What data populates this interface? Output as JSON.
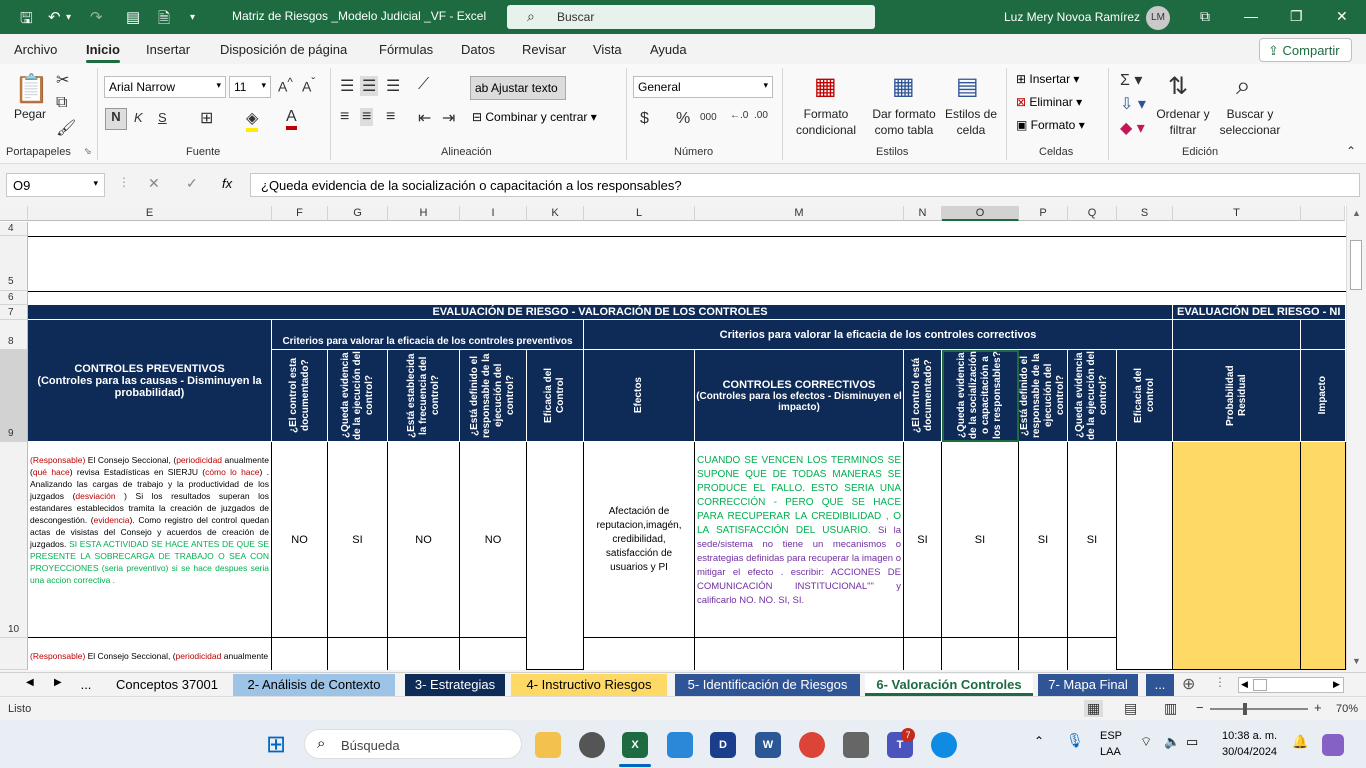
{
  "window": {
    "title": "Matriz de Riesgos _Modelo Judicial _VF  -  Excel",
    "search_placeholder": "Buscar",
    "user_name": "Luz Mery Novoa Ramírez",
    "user_initials": "LM"
  },
  "ribbon_tabs": [
    "Archivo",
    "Inicio",
    "Insertar",
    "Disposición de página",
    "Fórmulas",
    "Datos",
    "Revisar",
    "Vista",
    "Ayuda"
  ],
  "share_label": "Compartir",
  "ribbon": {
    "paste_label": "Pegar",
    "font_name": "Arial Narrow",
    "font_size": "11",
    "bold": "N",
    "italic": "K",
    "underline": "S",
    "wrap_text": "Ajustar texto",
    "merge_center": "Combinar y centrar",
    "number_format": "General",
    "conditional_format": "Formato condicional",
    "format_as_table": "Dar formato como tabla",
    "cell_styles": "Estilos de celda",
    "insert": "Insertar",
    "delete": "Eliminar",
    "format": "Formato",
    "sort_filter": "Ordenar y filtrar",
    "find_select": "Buscar y seleccionar",
    "groups": [
      "Portapapeles",
      "Fuente",
      "Alineación",
      "Número",
      "Estilos",
      "Celdas",
      "Edición"
    ]
  },
  "formula_bar": {
    "name_box": "O9",
    "fx": "fx",
    "formula": "¿Queda evidencia de la socialización o capacitación a los responsables?"
  },
  "columns": [
    "E",
    "F",
    "G",
    "H",
    "I",
    "K",
    "L",
    "M",
    "N",
    "O",
    "P",
    "Q",
    "S",
    "T"
  ],
  "rows": [
    "4",
    "5",
    "6",
    "7",
    "8",
    "9",
    "10"
  ],
  "sheet": {
    "title_main": "EVALUACIÓN DE RIESGO - VALORACIÓN DE LOS CONTROLES",
    "title_right": "EVALUACIÓN DEL RIESGO - NI",
    "criteria_preventive": "Criterios para valorar la eficacia de los controles preventivos",
    "criteria_corrective": "Criterios para  valorar la eficacia de los controles correctivos",
    "preventive_header": "CONTROLES PREVENTIVOS",
    "preventive_sub": "(Controles para las causas - Disminuyen la probabilidad)",
    "col_documented": "¿El control esta documentado?",
    "col_evidence": "¿Queda evidencia de la ejecución del control?",
    "col_frequency": "¿Está establecida la frecuencia del control?",
    "col_responsible": "¿Está definido el responsable de la ejecución del control?",
    "col_efficacy": "Eficacia del Control",
    "col_effects": "Efectos",
    "corrective_header": "CONTROLES CORRECTIVOS",
    "corrective_sub": "(Controles para los efectos - Disminuyen el impacto)",
    "col_n": "¿El control está documentado?",
    "col_o": "¿Queda evidencia de la socialización o capacitación a los responsables?",
    "col_p": "¿Está definido el responsable de la ejecución del control?",
    "col_q": "¿Queda evidencia de la ejecución del control?",
    "col_s": "Eficacia del control",
    "col_prob": "Probabilidad Residual",
    "col_impact": "Impacto",
    "row10": {
      "e_parts": [
        {
          "t": "(Responsable)",
          "c": "#c00000"
        },
        {
          "t": " El Consejo Seccional, (",
          "c": "#000"
        },
        {
          "t": "periodicidad",
          "c": "#c00000"
        },
        {
          "t": " anualmente (",
          "c": "#000"
        },
        {
          "t": "qué hace",
          "c": "#c00000"
        },
        {
          "t": ") revisa Estadísticas en SIERJU (",
          "c": "#000"
        },
        {
          "t": "cómo lo hace",
          "c": "#c00000"
        },
        {
          "t": ") . Analizando las cargas de trabajo y la productividad de los juzgados (",
          "c": "#000"
        },
        {
          "t": "desviación ",
          "c": "#c00000"
        },
        {
          "t": ") Si los resultados superan los estandares establecidos tramita la creación de juzgados de descongestión. (",
          "c": "#000"
        },
        {
          "t": "evidencia",
          "c": "#c00000"
        },
        {
          "t": "). Como registro del control quedan actas de visistas del Consejo y acuerdos de creación de juzgados. ",
          "c": "#000"
        },
        {
          "t": "SI ESTA ACTIVIDAD SE HACE ANTES DE QUE SE PRESENTE LA SOBRECARGA DE TRABAJO O SEA CON PROYECCIONES (seria preventivo) si se hace despues seria una accion correctiva .",
          "c": "#00b050"
        }
      ],
      "f": "NO",
      "g": "SI",
      "h": "NO",
      "i": "NO",
      "l": "Afectación de reputacion,imagén, credibilidad, satisfacción de usuarios y PI",
      "m_green": "CUANDO SE VENCEN LOS TERMINOS SE SUPONE QUE DE TODAS MANERAS SE PRODUCE EL FALLO. ESTO SERIA UNA CORRECCIÓN - PERO QUE SE HACE PARA RECUPERAR LA CREDIBILIDAD , O LA SATISFACCIÓN DEL USUARIO.",
      "m_purple": "Si la sede/sistema no tiene un mecanismos o estrategias definidas para recuperar la imagen o mitigar el efecto  . escribir: ACCIONES DE COMUNICACIÓN INSTITUCIONAL\"\" y calificarlo NO. NO. SI, SI.",
      "n": "SI",
      "o": "SI",
      "p": "SI",
      "q": "SI"
    },
    "row11_e_parts": [
      {
        "t": "(Responsable)",
        "c": "#c00000"
      },
      {
        "t": " El Consejo Seccional, (",
        "c": "#000"
      },
      {
        "t": "periodicidad",
        "c": "#c00000"
      },
      {
        "t": " anualmente",
        "c": "#000"
      }
    ]
  },
  "sheet_tabs": [
    {
      "label": "...",
      "bg": "#f3f3f3",
      "fg": "#222"
    },
    {
      "label": "Conceptos 37001",
      "bg": "#f3f3f3",
      "fg": "#222"
    },
    {
      "label": "2- Análisis de Contexto",
      "bg": "#9dc3e6",
      "fg": "#222"
    },
    {
      "label": "3- Estrategias",
      "bg": "#0e2a57",
      "fg": "#fff"
    },
    {
      "label": "4- Instructivo Riesgos",
      "bg": "#ffd966",
      "fg": "#222"
    },
    {
      "label": "5- Identificación de Riesgos",
      "bg": "#2f5597",
      "fg": "#fff"
    },
    {
      "label": "6- Valoración Controles",
      "bg": "#ffffff",
      "fg": "#1e6b41"
    },
    {
      "label": "7- Mapa Final",
      "bg": "#2f5597",
      "fg": "#fff"
    },
    {
      "label": "...",
      "bg": "#2f5597",
      "fg": "#fff"
    }
  ],
  "status": {
    "ready": "Listo",
    "zoom": "70%"
  },
  "taskbar": {
    "search_placeholder": "Búsqueda",
    "lang": "ESP",
    "lang2": "LAA",
    "time": "10:38 a. m.",
    "date": "30/04/2024",
    "badge": "7"
  }
}
